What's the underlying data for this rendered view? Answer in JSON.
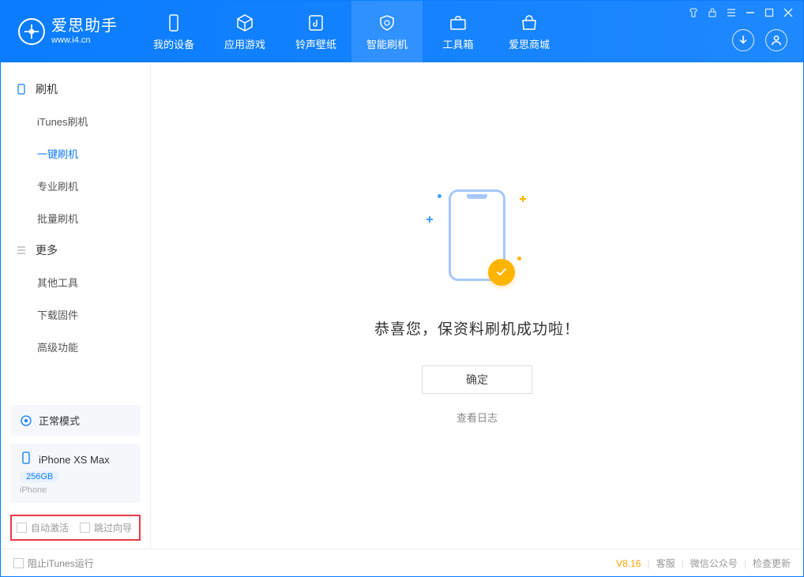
{
  "app": {
    "title": "爱思助手",
    "subtitle": "www.i4.cn"
  },
  "nav": [
    {
      "label": "我的设备"
    },
    {
      "label": "应用游戏"
    },
    {
      "label": "铃声壁纸"
    },
    {
      "label": "智能刷机"
    },
    {
      "label": "工具箱"
    },
    {
      "label": "爱思商城"
    }
  ],
  "sidebar": {
    "group1": {
      "title": "刷机"
    },
    "items1": [
      {
        "label": "iTunes刷机"
      },
      {
        "label": "一键刷机"
      },
      {
        "label": "专业刷机"
      },
      {
        "label": "批量刷机"
      }
    ],
    "group2": {
      "title": "更多"
    },
    "items2": [
      {
        "label": "其他工具"
      },
      {
        "label": "下载固件"
      },
      {
        "label": "高级功能"
      }
    ],
    "mode": "正常模式",
    "device": {
      "name": "iPhone XS Max",
      "capacity": "256GB",
      "type": "iPhone"
    },
    "checks": {
      "auto_activate": "自动激活",
      "skip_guide": "跳过向导"
    }
  },
  "main": {
    "success": "恭喜您，保资料刷机成功啦！",
    "confirm": "确定",
    "view_log": "查看日志"
  },
  "footer": {
    "block_itunes": "阻止iTunes运行",
    "version": "V8.16",
    "links": {
      "support": "客服",
      "wechat": "微信公众号",
      "update": "检查更新"
    }
  }
}
